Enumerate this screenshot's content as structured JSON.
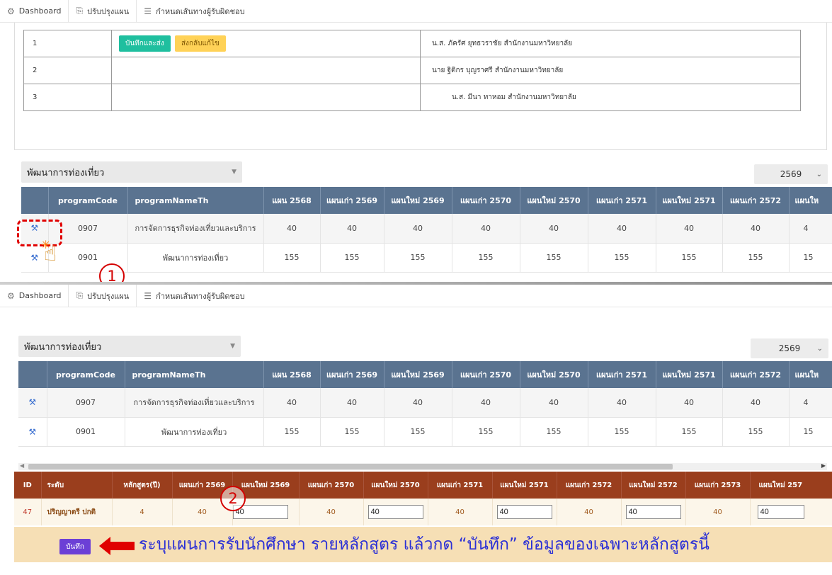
{
  "nav": [
    {
      "icon": "settings-icon",
      "label": "Dashboard"
    },
    {
      "icon": "document-icon",
      "label": "ปรับปรุงแผน"
    },
    {
      "icon": "list-icon",
      "label": "กำหนดเส้นทางผู้รับผิดชอบ"
    }
  ],
  "approvers": [
    {
      "no": "1",
      "name": "น.ส. ภัครัศ ยุทธวราชัย สำนักงานมหาวิทยาลัย"
    },
    {
      "no": "2",
      "name": "นาย ฐิติกร บุญราศรี สำนักงานมหาวิทยาลัย"
    },
    {
      "no": "3",
      "name": "น.ส. มีนา ทาหอม สำนักงานมหาวิทยาลัย"
    }
  ],
  "approver_actions": {
    "save_send": "บันทึกและส่ง",
    "return_edit": "ส่งกลับแก้ไข"
  },
  "filter": {
    "faculty": "พัฒนาการท่องเที่ยว",
    "year": "2569"
  },
  "program_table": {
    "columns": [
      "programCode",
      "programNameTh",
      "แผน 2568",
      "แผนเก่า 2569",
      "แผนใหม่ 2569",
      "แผนเก่า 2570",
      "แผนใหม่ 2570",
      "แผนเก่า 2571",
      "แผนใหม่ 2571",
      "แผนเก่า 2572",
      "แผนให"
    ],
    "rows": [
      {
        "code": "0907",
        "name": "การจัดการธุรกิจท่องเที่ยวและบริการ",
        "values": [
          "40",
          "40",
          "40",
          "40",
          "40",
          "40",
          "40",
          "40",
          "4"
        ]
      },
      {
        "code": "0901",
        "name": "พัฒนาการท่องเที่ยว",
        "values": [
          "155",
          "155",
          "155",
          "155",
          "155",
          "155",
          "155",
          "155",
          "15"
        ]
      }
    ]
  },
  "detail_table": {
    "columns": [
      "ID",
      "ระดับ",
      "หลักสูตร(ปี)",
      "แผนเก่า 2569",
      "แผนใหม่ 2569",
      "แผนเก่า 2570",
      "แผนใหม่ 2570",
      "แผนเก่า 2571",
      "แผนใหม่ 2571",
      "แผนเก่า 2572",
      "แผนใหม่ 2572",
      "แผนเก่า 2573",
      "แผนใหม่ 257"
    ],
    "row": {
      "id": "47",
      "level": "ปริญญาตรี ปกติ",
      "years": "4",
      "old_2569": "40",
      "new_2569": "40",
      "old_2570": "40",
      "new_2570": "40",
      "old_2571": "40",
      "new_2571": "40",
      "old_2572": "40",
      "new_2572": "40",
      "old_2573": "40",
      "new_2573": "40"
    }
  },
  "save_button": "บันทึก",
  "annotation": {
    "step1": "1",
    "step2": "2",
    "instruction": "ระบุแผนการรับนักศึกษา รายหลักสูตร แล้วกด “บันทึก” ข้อมูลของเฉพาะหลักสูตรนี้"
  }
}
